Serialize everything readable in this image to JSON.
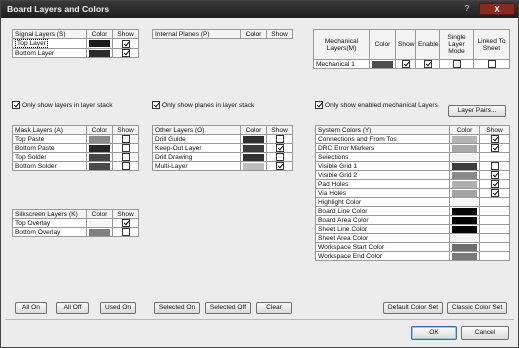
{
  "window": {
    "title": "Board Layers and Colors",
    "help_icon": "?",
    "close_icon": "X"
  },
  "signal": {
    "header": "Signal Layers (S)",
    "color_col": "Color",
    "show_col": "Show",
    "rows": [
      {
        "name": "Top Layer",
        "color": "#1a1a1a",
        "show": true,
        "selected": true
      },
      {
        "name": "Bottom Layer",
        "color": "#2a2a2a",
        "show": true
      }
    ],
    "option": "Only show layers in layer stack",
    "option_checked": true
  },
  "internal": {
    "header": "Internal Planes (P)",
    "color_col": "Color",
    "show_col": "Show",
    "option": "Only show planes in layer stack",
    "option_checked": true
  },
  "mechanical": {
    "header": "Mechanical Layers(M)",
    "color_col": "Color",
    "show_col": "Show",
    "enable_col": "Enable",
    "single_col": "Single Layer Mode",
    "linked_col": "Linked To Sheet",
    "rows": [
      {
        "name": "Mechanical 1",
        "color": "#4d4d4d",
        "show": true,
        "enable": true,
        "single": false,
        "linked": false
      }
    ],
    "option": "Only show enabled mechanical Layers",
    "option_checked": true,
    "layer_pairs": "Layer Pairs..."
  },
  "mask": {
    "header": "Mask Layers (A)",
    "color_col": "Color",
    "show_col": "Show",
    "rows": [
      {
        "name": "Top Paste",
        "color": "#8c8c8c",
        "show": false
      },
      {
        "name": "Bottom Paste",
        "color": "#262626",
        "show": false
      },
      {
        "name": "Top Solder",
        "color": "#474747",
        "show": false
      },
      {
        "name": "Bottom Solder",
        "color": "#4a4a4a",
        "show": false
      }
    ]
  },
  "other": {
    "header": "Other Layers (O)",
    "color_col": "Color",
    "show_col": "Show",
    "rows": [
      {
        "name": "Drill Guide",
        "color": "#2f2f2f",
        "show": false
      },
      {
        "name": "Keep-Out Layer",
        "color": "#3a3a3a",
        "show": true
      },
      {
        "name": "Drill Drawing",
        "color": "#333333",
        "show": false
      },
      {
        "name": "Multi-Layer",
        "color": "#bdbdbd",
        "show": true
      }
    ]
  },
  "system": {
    "header": "System Colors (Y)",
    "color_col": "Color",
    "show_col": "Show",
    "rows": [
      {
        "name": "Connections and From Tos",
        "color": "#b5b5b5",
        "show": true,
        "has_show": true
      },
      {
        "name": "DRC Error Markers",
        "color": "#a8a8a8",
        "show": true,
        "has_show": true
      },
      {
        "name": "Selections",
        "color": "#f0f0f0",
        "has_show": false
      },
      {
        "name": "Visible Grid 1",
        "color": "#3d3d3d",
        "show": false,
        "has_show": true
      },
      {
        "name": "Visible Grid 2",
        "color": "#8a8a8a",
        "show": true,
        "has_show": true
      },
      {
        "name": "Pad Holes",
        "color": "#b0b0b0",
        "show": true,
        "has_show": true
      },
      {
        "name": "Via Holes",
        "color": "#a3a3a3",
        "show": true,
        "has_show": true
      },
      {
        "name": "Highlight Color",
        "color": "#f7f7f7",
        "has_show": false
      },
      {
        "name": "Board Line Color",
        "color": "#050505",
        "has_show": false
      },
      {
        "name": "Board Area Color",
        "color": "#000000",
        "has_show": false
      },
      {
        "name": "Sheet Line Color",
        "color": "#050505",
        "has_show": false
      },
      {
        "name": "Sheet Area Color",
        "color": "#f4f4f4",
        "has_show": false
      },
      {
        "name": "Workspace Start Color",
        "color": "#6e6e6e",
        "has_show": false
      },
      {
        "name": "Workspace End Color",
        "color": "#7a7a7a",
        "has_show": false
      }
    ]
  },
  "silkscreen": {
    "header": "Silkscreen Layers (K)",
    "color_col": "Color",
    "show_col": "Show",
    "rows": [
      {
        "name": "Top Overlay",
        "color": "#f5f5f5",
        "show": true
      },
      {
        "name": "Bottom Overlay",
        "color": "#808080",
        "show": false
      }
    ]
  },
  "buttons": {
    "all_on": "All On",
    "all_off": "All Off",
    "used_on": "Used On",
    "selected_on": "Selected On",
    "selected_off": "Selected Off",
    "clear": "Clear",
    "default_color_set": "Default Color Set",
    "classic_color_set": "Classic Color Set",
    "ok": "OK",
    "cancel": "Cancel"
  }
}
